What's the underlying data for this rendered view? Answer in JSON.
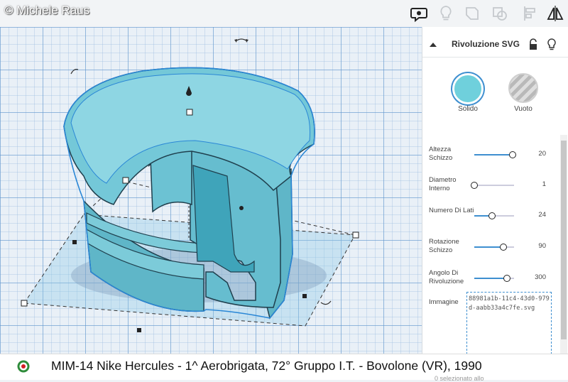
{
  "watermark": "© Michele Raus",
  "toolbar": {
    "icons": [
      "comment-icon",
      "bulb-icon",
      "shape-outline-icon",
      "group-icon",
      "align-icon",
      "mirror-icon"
    ]
  },
  "panel": {
    "title": "Rivoluzione SVG",
    "modes": {
      "solid": "Solido",
      "hole": "Vuoto"
    },
    "props": [
      {
        "label": "Altezza Schizzo",
        "value": "20",
        "fraction": 0.97
      },
      {
        "label": "Diametro Interno",
        "value": "1",
        "fraction": 0.0
      },
      {
        "label": "Numero Di Lati",
        "value": "24",
        "fraction": 0.45
      },
      {
        "label": "Rotazione Schizzo",
        "value": "90",
        "fraction": 0.73
      },
      {
        "label": "Angolo Di Rivoluzione",
        "value": "300",
        "fraction": 0.83
      }
    ],
    "image_label": "Immagine",
    "image_name": "88981a1b-11c4-43d0-979d-aabb33a4c7fe.svg"
  },
  "caption": "MIM-14 Nike Hercules - 1^ Aerobrigata, 72° Gruppo I.T. - Bovolone (VR), 1990",
  "footer_partial": "0 selezionato allo",
  "colors": {
    "shape": "#6fc4d6",
    "selection": "#2a87d6",
    "accent": "#3e8fd0"
  }
}
